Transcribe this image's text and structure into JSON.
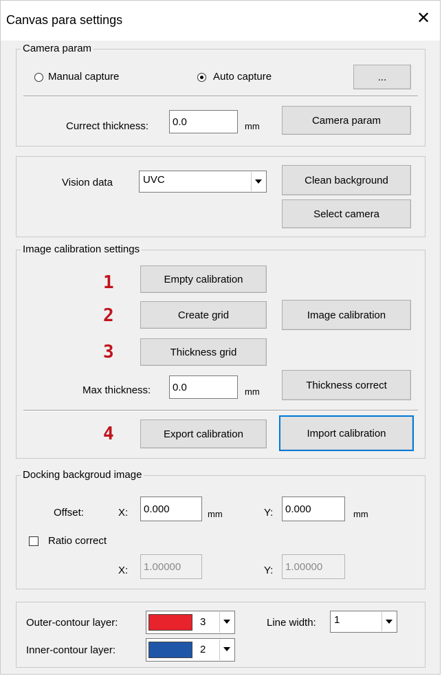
{
  "window": {
    "title": "Canvas para settings",
    "close_glyph": "✕"
  },
  "camera_param": {
    "legend": "Camera param",
    "manual_capture": "Manual capture",
    "auto_capture": "Auto capture",
    "selected_mode": "Auto capture",
    "more_button": "...",
    "thickness_label": "Currect thickness:",
    "thickness_value": "0.0",
    "thickness_unit": "mm",
    "camera_param_button": "Camera param"
  },
  "vision": {
    "label": "Vision data",
    "value": "UVC",
    "clean_background_button": "Clean background",
    "select_camera_button": "Select camera"
  },
  "image_calibration": {
    "legend": "Image calibration settings",
    "steps": [
      "1",
      "2",
      "3",
      "4"
    ],
    "step_color": "#c0141c",
    "empty_calibration_button": "Empty calibration",
    "create_grid_button": "Create grid",
    "image_calibration_button": "Image calibration",
    "thickness_grid_button": "Thickness grid",
    "max_thickness_label": "Max thickness:",
    "max_thickness_value": "0.0",
    "max_thickness_unit": "mm",
    "thickness_correct_button": "Thickness correct",
    "export_calibration_button": "Export calibration",
    "import_calibration_button": "Import calibration"
  },
  "docking": {
    "legend": "Docking backgroud image",
    "offset_label": "Offset:",
    "x_label": "X:",
    "x_value": "0.000",
    "y_label": "Y:",
    "y_value": "0.000",
    "unit": "mm",
    "ratio_correct_label": "Ratio correct",
    "ratio_correct_checked": false,
    "ratio_x_label": "X:",
    "ratio_x_value": "1.00000",
    "ratio_y_label": "Y:",
    "ratio_y_value": "1.00000"
  },
  "layers": {
    "outer_label": "Outer-contour layer:",
    "outer_value": "3",
    "outer_color": "#e8232b",
    "inner_label": "Inner-contour layer:",
    "inner_value": "2",
    "inner_color": "#1f56a8",
    "line_width_label": "Line width:",
    "line_width_value": "1"
  }
}
